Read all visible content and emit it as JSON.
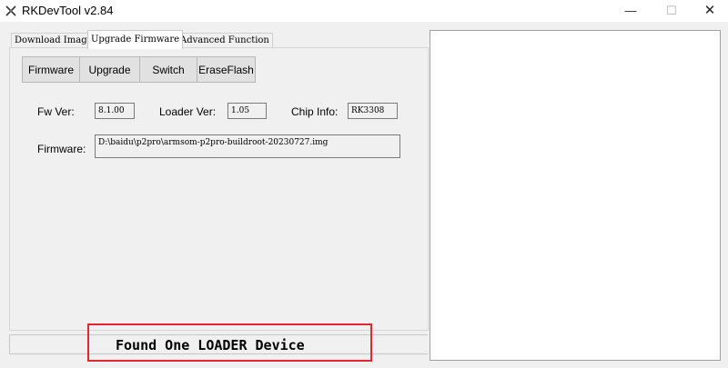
{
  "window": {
    "title": "RKDevTool v2.84",
    "minimize_glyph": "—",
    "maximize_glyph": "☐",
    "close_glyph": "✕",
    "icon": "rkdevtool-app-icon"
  },
  "tabs": [
    {
      "label": "Download Image",
      "active": false
    },
    {
      "label": "Upgrade Firmware",
      "active": true
    },
    {
      "label": "Advanced Function",
      "active": false
    }
  ],
  "toolbar": {
    "firmware_label": "Firmware",
    "upgrade_label": "Upgrade",
    "switch_label": "Switch",
    "eraseflash_label": "EraseFlash"
  },
  "info": {
    "fw_ver_label": "Fw Ver:",
    "fw_ver_value": "8.1.00",
    "loader_ver_label": "Loader Ver:",
    "loader_ver_value": "1.05",
    "chip_info_label": "Chip Info:",
    "chip_info_value": "RK3308",
    "firmware_label": "Firmware:",
    "firmware_path": "D:\\baidu\\p2pro\\armsom-p2pro-buildroot-20230727.img"
  },
  "status": {
    "text": "Found One LOADER Device",
    "highlight_color": "#e0282e"
  }
}
